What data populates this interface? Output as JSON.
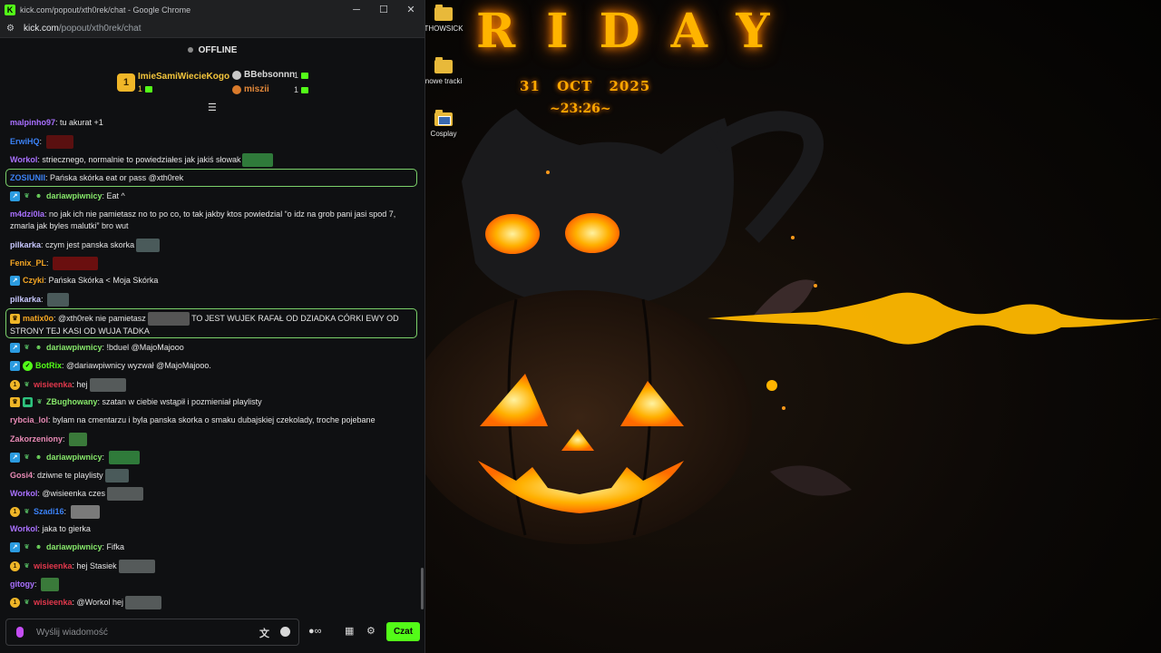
{
  "browser": {
    "title": "kick.com/popout/xth0rek/chat - Google Chrome",
    "url_host": "kick.com",
    "url_path": "/popout/xth0rek/chat",
    "favicon_letter": "K"
  },
  "stream": {
    "status": "OFFLINE"
  },
  "leaderboard": {
    "first": {
      "rank": "1",
      "name": "ImieSamiWiecieKogo",
      "count": "1"
    },
    "second": {
      "name": "BBebsonnn",
      "count": "1"
    },
    "third": {
      "name": "miszii",
      "count": "1"
    }
  },
  "messages": [
    {
      "user": "malpinho97",
      "color": "#a970ff",
      "text": "tu akurat +1"
    },
    {
      "user": "ErwiHQ",
      "color": "#3b82f6",
      "text": ""
    },
    {
      "user": "Workol",
      "color": "#a970ff",
      "text": "striecznego, normalnie to powiedziałes jak jakiś słowak"
    },
    {
      "user": "ZOSIUNII",
      "color": "#3b82f6",
      "text": "Pańska skórka eat or pass @xth0rek"
    },
    {
      "user": "dariawpiwnicy",
      "color": "#86e86a",
      "text": "Eat ^"
    },
    {
      "user": "m4dzi0la",
      "color": "#a970ff",
      "text": "no jak ich nie pamietasz no to po co, to tak jakby ktos powiedzial “o idz na grob pani jasi spod 7, zmarla jak byles malutki” bro wut"
    },
    {
      "user": "pilkarka",
      "color": "#c8c8ff",
      "text": "czym jest panska skorka"
    },
    {
      "user": "Fenix_PL",
      "color": "#f5a623",
      "text": ""
    },
    {
      "user": "Czyki",
      "color": "#f5a623",
      "text": "Pańska Skórka < Moja Skórka"
    },
    {
      "user": "pilkarka",
      "color": "#c8c8ff",
      "text": ""
    },
    {
      "user": "matix0o",
      "color": "#f5a623",
      "text_before": "@xth0rek nie pamietasz",
      "text_after": "TO JEST WUJEK RAFAŁ OD DZIADKA CÓRKI EWY OD STRONY TEJ KASI OD WUJA TADKA"
    },
    {
      "user": "dariawpiwnicy",
      "color": "#86e86a",
      "text": "!bduel @MajoMajooo"
    },
    {
      "user": "BotRix",
      "color": "#53fc18",
      "text": "@dariawpiwnicy wyzwał @MajoMajooo."
    },
    {
      "user": "wisieenka",
      "color": "#e2384c",
      "text": "hej"
    },
    {
      "user": "ZBughowany",
      "color": "#86e86a",
      "text": "szatan w ciebie wstąpił i pozmieniał playlisty"
    },
    {
      "user": "rybcia_lol",
      "color": "#e88ab5",
      "text": "bylam na cmentarzu i byla panska skorka o smaku dubajskiej czekolady, troche pojebane"
    },
    {
      "user": "Zakorzeniony",
      "color": "#e88ab5",
      "text": ""
    },
    {
      "user": "dariawpiwnicy",
      "color": "#86e86a",
      "text": ""
    },
    {
      "user": "Gosi4",
      "color": "#e88ab5",
      "text": "dziwne te playlisty"
    },
    {
      "user": "Workol",
      "color": "#a970ff",
      "text": "@wisieenka czes"
    },
    {
      "user": "Szadi16",
      "color": "#3b82f6",
      "text": ""
    },
    {
      "user": "Workol",
      "color": "#a970ff",
      "text": "jaka to gierka"
    },
    {
      "user": "dariawpiwnicy",
      "color": "#86e86a",
      "text": "Fifka"
    },
    {
      "user": "wisieenka",
      "color": "#e2384c",
      "text": "hej Stasiek"
    },
    {
      "user": "gitogy",
      "color": "#a970ff",
      "text": ""
    },
    {
      "user": "wisieenka",
      "color": "#e2384c",
      "text": "@Workol hej"
    }
  ],
  "input": {
    "placeholder": "Wyślij wiadomość",
    "send_label": "Czat"
  },
  "desktop": {
    "wallpaper_title": "RIDAY",
    "date_text": "31 OCT 2025",
    "time_text": "~23:26~",
    "icons": [
      {
        "label": "THOWSICK"
      },
      {
        "label": "nowe tracki"
      },
      {
        "label": "Cosplay"
      }
    ]
  },
  "colors": {
    "kick_green": "#53fc18",
    "gold": "#f0b628",
    "highlight_border": "#7bd16a"
  }
}
